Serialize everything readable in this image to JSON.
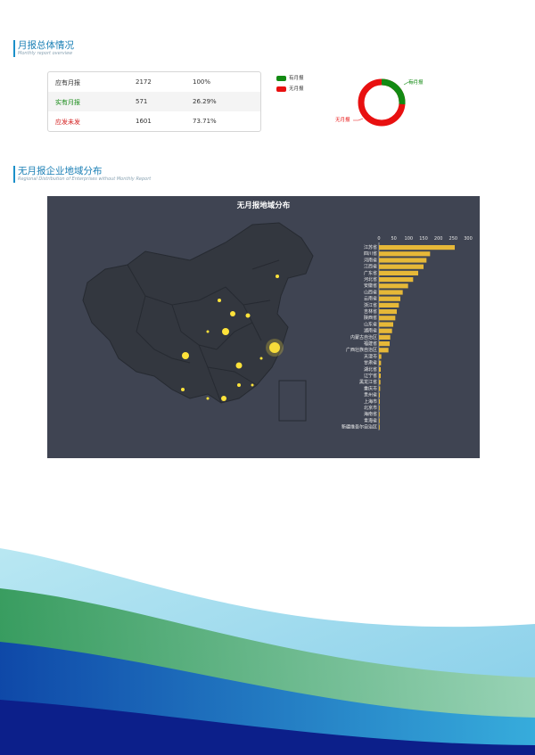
{
  "section1": {
    "title": "月报总体情况",
    "subtitle": "Monthly report overview"
  },
  "stats": [
    {
      "label": "应有月报",
      "count": "2172",
      "percent": "100%",
      "color": "#333333"
    },
    {
      "label": "实有月报",
      "count": "571",
      "percent": "26.29%",
      "color": "#1a8c1a"
    },
    {
      "label": "应发未发",
      "count": "1601",
      "percent": "73.71%",
      "color": "#d42020"
    }
  ],
  "donut": {
    "legend": [
      {
        "name": "有月报",
        "color": "#138a13"
      },
      {
        "name": "无月报",
        "color": "#e81010"
      }
    ],
    "label_has": "有月报",
    "label_none": "无月报",
    "has_fraction": 0.2629
  },
  "section2": {
    "title": "无月报企业地域分布",
    "subtitle": "Regional Distribution of Enterprises without Monthly Report"
  },
  "map_panel": {
    "title": "无月报地域分布"
  },
  "chart_data": {
    "type": "bar",
    "orientation": "horizontal",
    "title": "无月报地域分布",
    "xlim": [
      0,
      300
    ],
    "x_ticks": [
      "0",
      "50",
      "100",
      "150",
      "200",
      "250",
      "300"
    ],
    "categories": [
      "江苏省",
      "四川省",
      "河南省",
      "江西省",
      "广东省",
      "河北省",
      "安徽省",
      "山西省",
      "云南省",
      "浙江省",
      "吉林省",
      "陕西省",
      "山东省",
      "湖南省",
      "内蒙古自治区",
      "福建省",
      "广西壮族自治区",
      "天津市",
      "甘肃省",
      "湖北省",
      "辽宁省",
      "黑龙江省",
      "重庆市",
      "贵州省",
      "上海市",
      "北京市",
      "海南省",
      "青海省",
      "新疆维吾尔自治区"
    ],
    "values": [
      255,
      172,
      160,
      150,
      132,
      115,
      98,
      80,
      72,
      67,
      60,
      55,
      48,
      44,
      38,
      36,
      32,
      8,
      7,
      6,
      6,
      5,
      4,
      3,
      3,
      2,
      2,
      1,
      1
    ],
    "bar_color": "#e6b838"
  }
}
